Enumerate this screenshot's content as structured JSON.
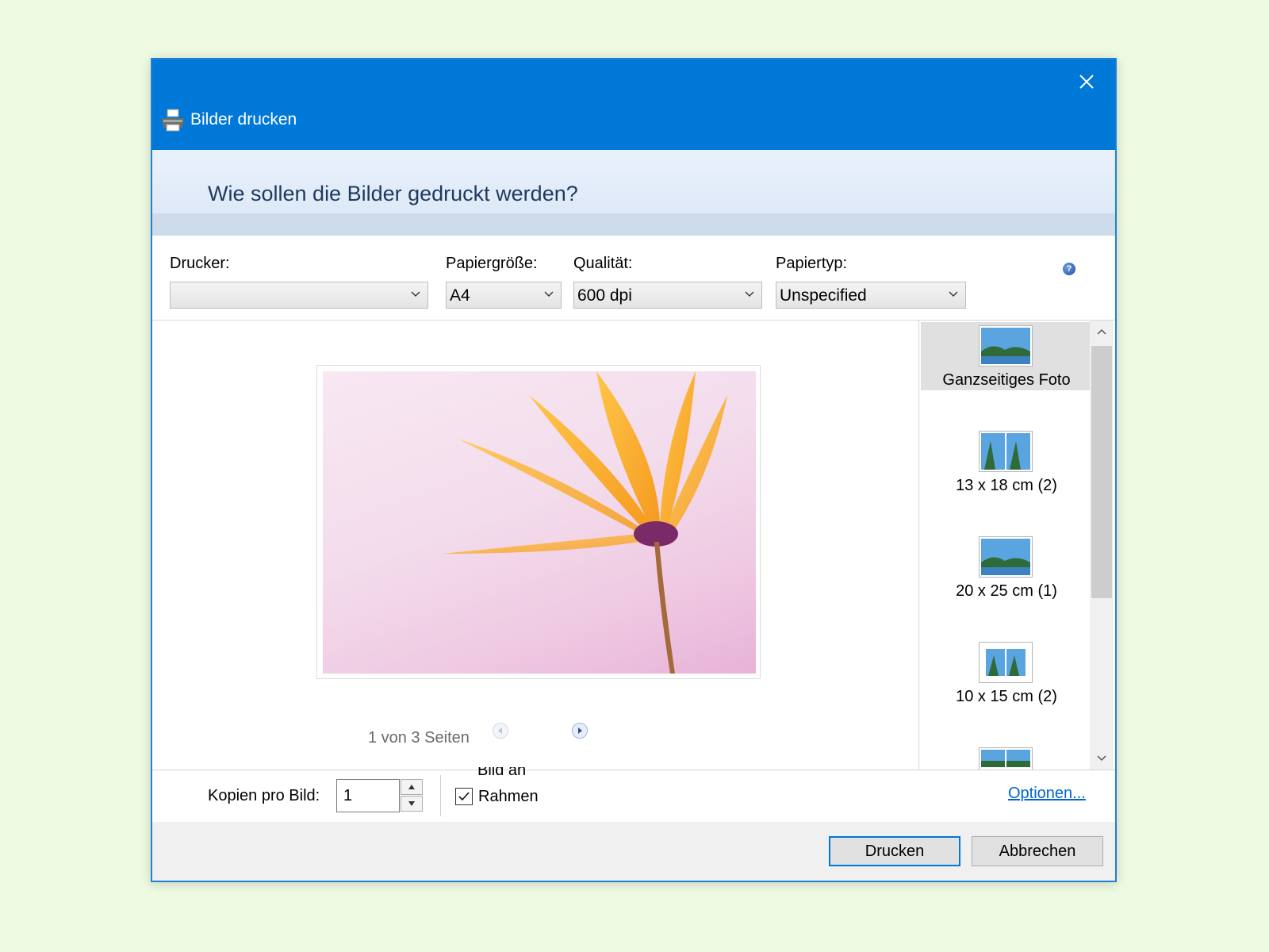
{
  "window": {
    "title": "Bilder drucken"
  },
  "header": {
    "heading": "Wie sollen die Bilder gedruckt werden?"
  },
  "settings": {
    "printer": {
      "label": "Drucker:",
      "value": ""
    },
    "paper_size": {
      "label": "Papiergröße:",
      "value": "A4"
    },
    "quality": {
      "label": "Qualität:",
      "value": "600 dpi"
    },
    "paper_type": {
      "label": "Papiertyp:",
      "value": "Unspecified"
    }
  },
  "preview": {
    "page_indicator": "1 von 3 Seiten"
  },
  "layouts": [
    {
      "label": "Ganzseitiges Foto",
      "selected": true
    },
    {
      "label": "13 x 18 cm (2)",
      "selected": false
    },
    {
      "label": "20 x 25 cm (1)",
      "selected": false
    },
    {
      "label": "10 x 15 cm (2)",
      "selected": false
    },
    {
      "label": "",
      "selected": false
    }
  ],
  "bottom": {
    "copies_label": "Kopien pro Bild:",
    "copies_value": "1",
    "fit_label": "Bild an",
    "frame_label": "Rahmen",
    "frame_checked": true,
    "options_link": "Optionen..."
  },
  "footer": {
    "print_button": "Drucken",
    "cancel_button": "Abbrechen"
  },
  "colors": {
    "titlebar": "#0078d7",
    "accent": "#0078d7",
    "link": "#0066cc"
  },
  "icons": {
    "close": "close-icon",
    "printer": "printer-icon",
    "help": "help-icon",
    "chevron": "chevron-down-icon",
    "prev": "previous-page-icon",
    "next": "next-page-icon"
  }
}
